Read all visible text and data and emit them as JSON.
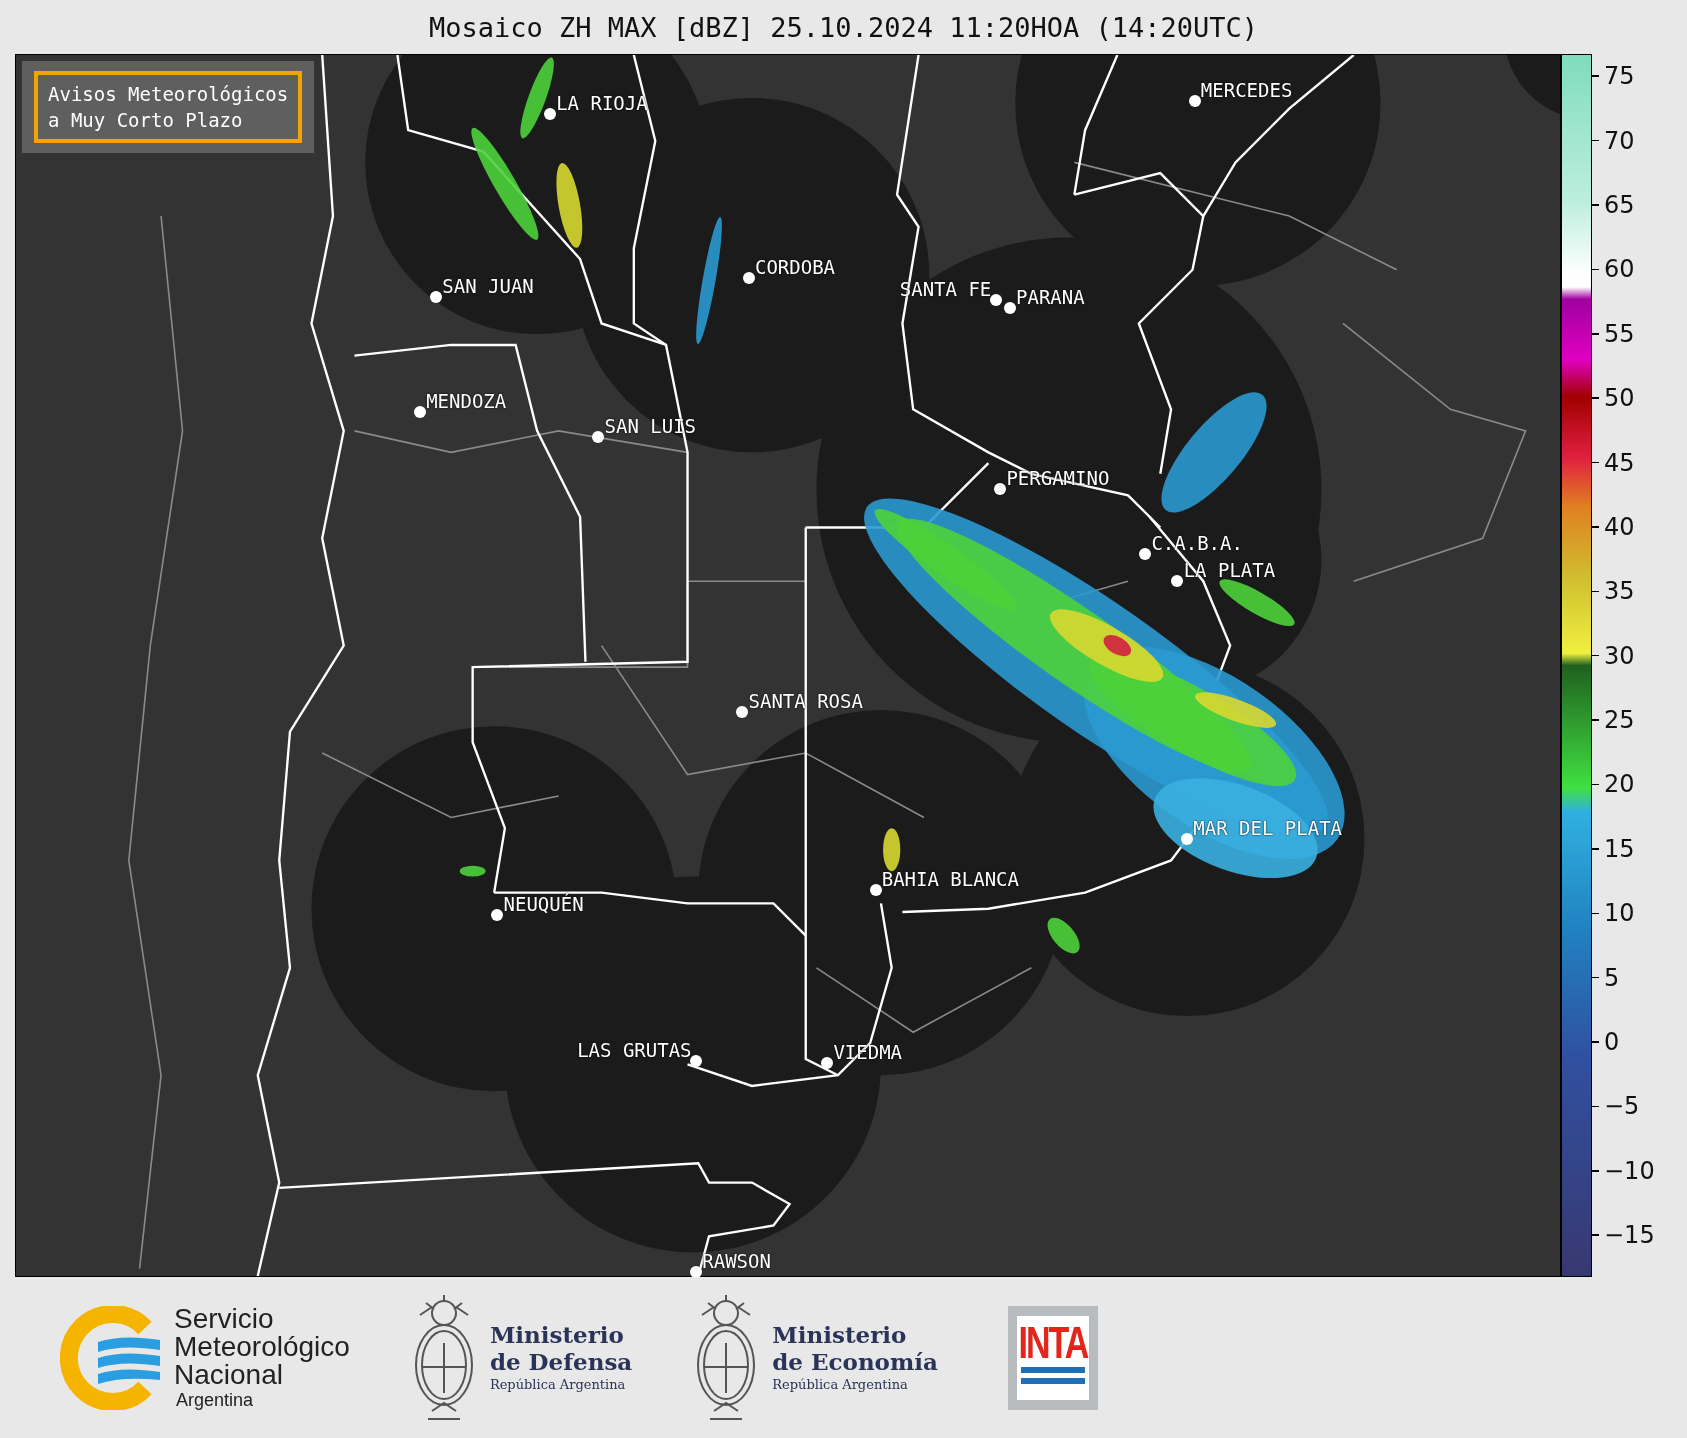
{
  "title": "Mosaico ZH MAX [dBZ] 25.10.2024 11:20HOA (14:20UTC)",
  "notice": [
    "Avisos Meteorológicos",
    "a Muy Corto Plazo"
  ],
  "cities": [
    {
      "name": "LA RIOJA"
    },
    {
      "name": "MERCEDES"
    },
    {
      "name": "CORDOBA"
    },
    {
      "name": "SAN JUAN"
    },
    {
      "name": "SANTA FE"
    },
    {
      "name": "PARANA"
    },
    {
      "name": "MENDOZA"
    },
    {
      "name": "SAN LUIS"
    },
    {
      "name": "PERGAMINO"
    },
    {
      "name": "C.A.B.A."
    },
    {
      "name": "LA PLATA"
    },
    {
      "name": "SANTA ROSA"
    },
    {
      "name": "MAR DEL PLATA"
    },
    {
      "name": "BAHIA BLANCA"
    },
    {
      "name": "NEUQUÉN"
    },
    {
      "name": "LAS GRUTAS"
    },
    {
      "name": "VIEDMA"
    },
    {
      "name": "RAWSON"
    }
  ],
  "colorbar": {
    "ticks": [
      "75",
      "70",
      "65",
      "60",
      "55",
      "50",
      "45",
      "40",
      "35",
      "30",
      "25",
      "20",
      "15",
      "10",
      "5",
      "0",
      "−5",
      "−10",
      "−15"
    ]
  },
  "logos": [
    {
      "kind": "smn",
      "lines": [
        "Servicio",
        "Meteorológico",
        "Nacional",
        "Argentina"
      ]
    },
    {
      "kind": "ministry",
      "lines": [
        "Ministerio",
        "de Defensa",
        "República Argentina"
      ]
    },
    {
      "kind": "ministry",
      "lines": [
        "Ministerio",
        "de Economía",
        "República Argentina"
      ]
    },
    {
      "kind": "inta",
      "lines": [
        "INTA"
      ]
    }
  ]
}
